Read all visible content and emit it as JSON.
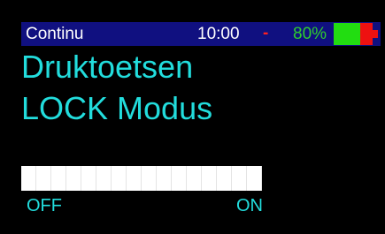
{
  "status_bar": {
    "mode": "Continu",
    "time": "10:00",
    "separator": "-",
    "battery_percent_label": "80%",
    "battery_level": 0.68,
    "colors": {
      "background": "#101080",
      "percent_text": "#2ecc2e",
      "separator": "#ff2020",
      "battery_fill": "#22dd11",
      "battery_empty": "#ee1111"
    }
  },
  "main": {
    "title_line_1": "Druktoetsen",
    "title_line_2": "LOCK Modus",
    "text_color": "#22dddd"
  },
  "toggle": {
    "off_label": "OFF",
    "on_label": "ON",
    "value": "OFF",
    "track_color": "#ffffff"
  }
}
